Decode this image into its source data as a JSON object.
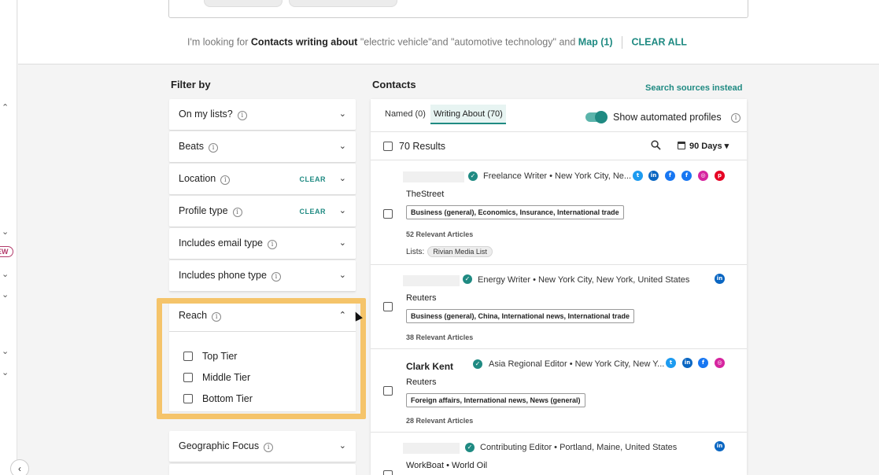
{
  "query": {
    "prefix": "I'm looking for",
    "entity": "Contacts writing about",
    "terms": "\"electric vehicle\"and \"automotive technology\"",
    "and": "and",
    "map": "Map (1)",
    "clear_all": "CLEAR ALL"
  },
  "filters": {
    "title": "Filter by",
    "items": [
      {
        "label": "On my lists?",
        "clear": ""
      },
      {
        "label": "Beats",
        "clear": ""
      },
      {
        "label": "Location",
        "clear": "CLEAR"
      },
      {
        "label": "Profile type",
        "clear": "CLEAR"
      },
      {
        "label": "Includes email type",
        "clear": ""
      },
      {
        "label": "Includes phone type",
        "clear": ""
      }
    ],
    "reach": {
      "label": "Reach",
      "options": [
        "Top Tier",
        "Middle Tier",
        "Bottom Tier"
      ]
    },
    "geographic_focus": "Geographic Focus"
  },
  "contacts": {
    "title": "Contacts",
    "search_sources": "Search sources instead",
    "tabs": [
      "Named (0)",
      "Writing About (70)"
    ],
    "show_automated": "Show automated profiles",
    "results": "70 Results",
    "range": "90 Days",
    "list": [
      {
        "name": "",
        "role": "Freelance Writer • New York City, Ne...",
        "outlet": "TheStreet",
        "beats": "Business (general), Economics, Insurance, International trade",
        "articles": "52 Relevant Articles",
        "lists_label": "Lists:",
        "list_chip": "Rivian Media List"
      },
      {
        "name": "",
        "role": "Energy Writer • New York City, New York, United States",
        "outlet": "Reuters",
        "beats": "Business (general), China, International news, International trade",
        "articles": "38 Relevant Articles"
      },
      {
        "name": "Clark Kent",
        "role": "Asia Regional Editor • New York City, New Y...",
        "outlet": "Reuters",
        "beats": "Foreign affairs, International news, News (general)",
        "articles": "28 Relevant Articles"
      },
      {
        "name": "",
        "role": "Contributing Editor • Portland, Maine, United States",
        "outlet": "WorkBoat • World Oil"
      }
    ]
  },
  "left_rail": {
    "new_badge": "EW"
  },
  "colors": {
    "accent": "#1f8a82",
    "highlight": "#f5c46a"
  }
}
